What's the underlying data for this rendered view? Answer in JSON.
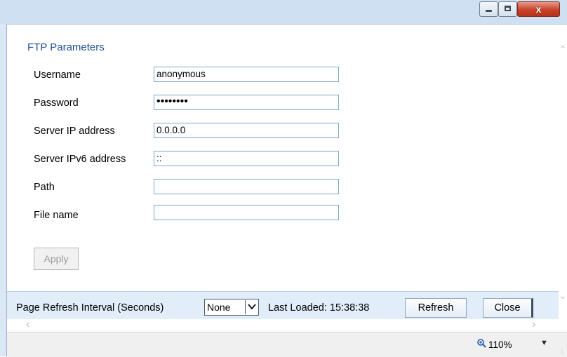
{
  "window": {
    "close_glyph": "x"
  },
  "ftp": {
    "section_title": "FTP Parameters",
    "fields": [
      {
        "label": "Username",
        "value": "anonymous"
      },
      {
        "label": "Password",
        "value": "••••••••"
      },
      {
        "label": "Server IP address",
        "value": "0.0.0.0"
      },
      {
        "label": "Server IPv6 address",
        "value": "::"
      },
      {
        "label": "Path",
        "value": ""
      },
      {
        "label": "File name",
        "value": ""
      }
    ],
    "apply_label": "Apply"
  },
  "toolbar": {
    "refresh_interval_label": "Page Refresh Interval (Seconds)",
    "refresh_interval_value": "None",
    "last_loaded": "Last Loaded: 15:38:38",
    "refresh_label": "Refresh",
    "close_label": "Close"
  },
  "statusbar": {
    "zoom": "110%"
  },
  "icons": {
    "minimize": "minimize-icon",
    "maximize": "maximize-icon",
    "close": "close-icon",
    "zoom": "zoom-icon",
    "dropdown": "chevron-down-icon"
  },
  "colors": {
    "section_title": "#1e4f8f",
    "field_border": "#7ea5cc",
    "toolbar_bg": "#e1edf9",
    "close_button": "#c8432b"
  }
}
